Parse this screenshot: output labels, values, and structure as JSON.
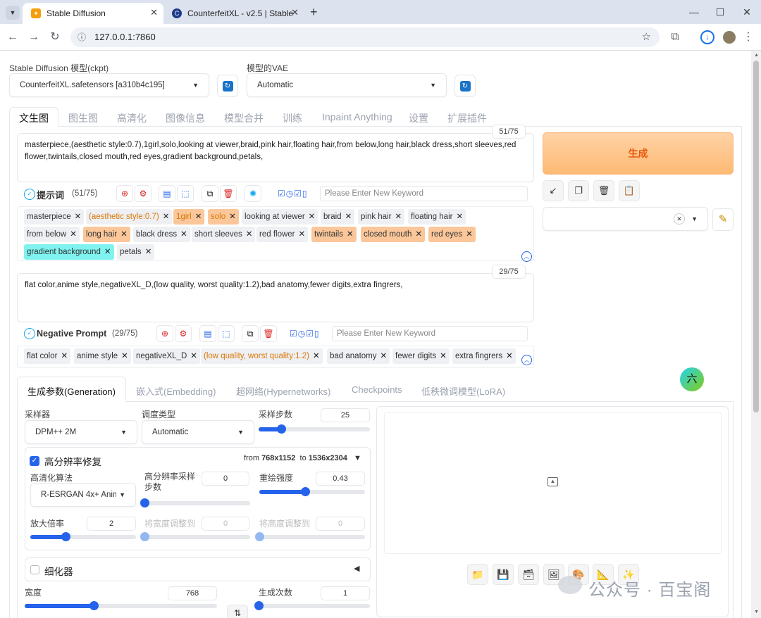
{
  "browser": {
    "tabs": [
      {
        "title": "Stable Diffusion",
        "active": true
      },
      {
        "title": "CounterfeitXL - v2.5 | Stable",
        "active": false
      }
    ],
    "url": "127.0.0.1:7860"
  },
  "models": {
    "ckpt_label": "Stable Diffusion 模型(ckpt)",
    "ckpt_value": "CounterfeitXL.safetensors [a310b4c195]",
    "vae_label": "模型的VAE",
    "vae_value": "Automatic"
  },
  "main_tabs": [
    "文生图",
    "图生图",
    "高清化",
    "图像信息",
    "模型合并",
    "训练",
    "Inpaint Anything",
    "设置",
    "扩展插件"
  ],
  "prompt": {
    "text": "masterpiece,(aesthetic style:0.7),1girl,solo,looking at viewer,braid,pink hair,floating hair,from below,long hair,black dress,short sleeves,red flower,twintails,closed mouth,red eyes,gradient background,petals,",
    "counter": "51/75",
    "title": "提示词",
    "title_count": "(51/75)",
    "keyword_placeholder": "Please Enter New Keyword",
    "chips": [
      "masterpiece",
      "(aesthetic style:0.7)",
      "1girl",
      "solo",
      "looking at viewer",
      "braid",
      "pink hair",
      "floating hair",
      "from below",
      "long hair",
      "black dress",
      "short sleeves",
      "red flower",
      "twintails",
      "closed mouth",
      "red eyes",
      "gradient background",
      "petals"
    ]
  },
  "negative": {
    "text": "flat color,anime style,negativeXL_D,(low quality, worst quality:1.2),bad anatomy,fewer digits,extra fingrers,",
    "counter": "29/75",
    "title": "Negative Prompt",
    "title_count": "(29/75)",
    "keyword_placeholder": "Please Enter New Keyword",
    "chips": [
      "flat color",
      "anime style",
      "negativeXL_D",
      "(low quality, worst quality:1.2)",
      "bad anatomy",
      "fewer digits",
      "extra fingrers"
    ]
  },
  "generate_label": "生成",
  "sub_tabs": [
    "生成参数(Generation)",
    "嵌入式(Embedding)",
    "超网络(Hypernetworks)",
    "Checkpoints",
    "低秩微调模型(LoRA)"
  ],
  "params": {
    "sampler_label": "采样器",
    "sampler_value": "DPM++ 2M",
    "schedule_label": "调度类型",
    "schedule_value": "Automatic",
    "steps_label": "采样步数",
    "steps_value": "25",
    "steps_fraction": 0.2,
    "hires_label": "高分辨率修复",
    "hires_from_prefix": "from",
    "hires_from": "768x1152",
    "hires_to_prefix": "to",
    "hires_to": "1536x2304",
    "upscaler_label": "高清化算法",
    "upscaler_value": "R-ESRGAN 4x+ Anime",
    "hires_steps_label": "高分辨率采样\n步数",
    "hires_steps_value": "0",
    "hires_steps_fraction": 0,
    "denoise_label": "重绘强度",
    "denoise_value": "0.43",
    "denoise_fraction": 0.43,
    "scale_label": "放大倍率",
    "scale_value": "2",
    "scale_fraction": 0.33,
    "resize_w_label": "将宽度调整到",
    "resize_w_value": "0",
    "resize_h_label": "将高度调整到",
    "resize_h_value": "0",
    "refiner_label": "细化器",
    "width_label": "宽度",
    "width_value": "768",
    "width_fraction": 0.36,
    "batch_count_label": "生成次数",
    "batch_count_value": "1",
    "batch_count_fraction": 0
  },
  "watermark": "公众号 · 百宝阁",
  "float_badge": "六"
}
